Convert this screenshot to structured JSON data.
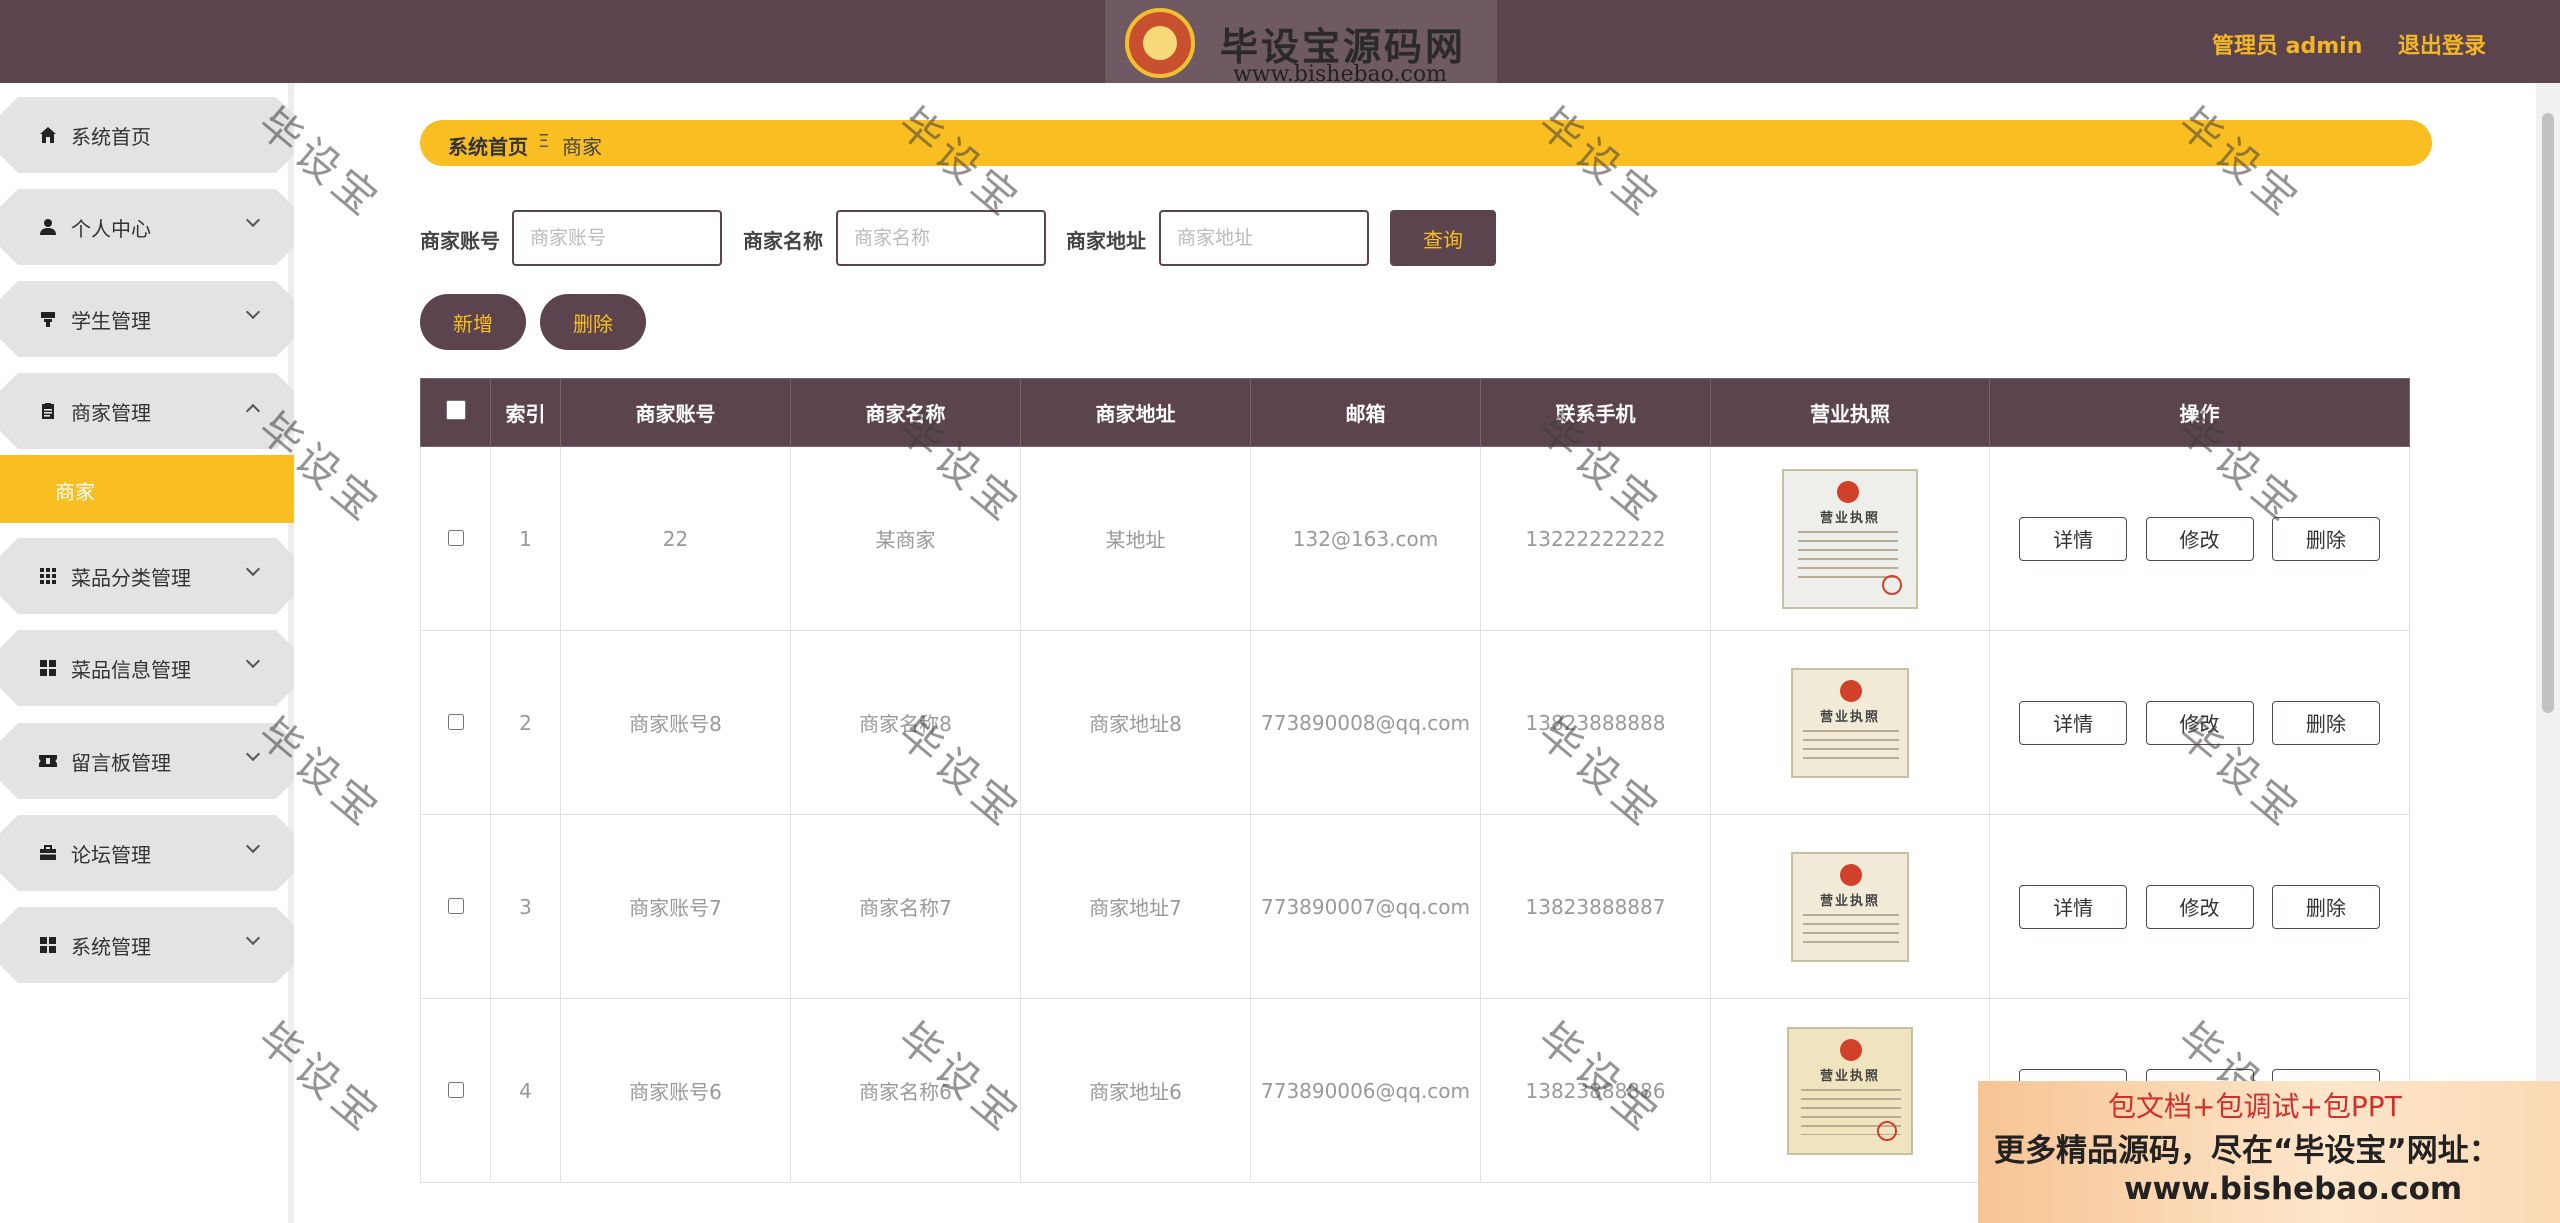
{
  "header": {
    "logo_title": "毕设宝源码网",
    "logo_url": "www.bishebao.com",
    "admin_label": "管理员 admin",
    "logout_label": "退出登录"
  },
  "sidebar": {
    "items": [
      {
        "label": "系统首页",
        "icon": "home-icon"
      },
      {
        "label": "个人中心",
        "icon": "user-icon"
      },
      {
        "label": "学生管理",
        "icon": "student-icon"
      },
      {
        "label": "商家管理",
        "icon": "clipboard-icon"
      },
      {
        "label": "菜品分类管理",
        "icon": "grid-icon"
      },
      {
        "label": "菜品信息管理",
        "icon": "apps-icon"
      },
      {
        "label": "留言板管理",
        "icon": "ticket-icon"
      },
      {
        "label": "论坛管理",
        "icon": "briefcase-icon"
      },
      {
        "label": "系统管理",
        "icon": "apps-icon"
      }
    ],
    "sub_item": "商家"
  },
  "breadcrumb": {
    "home": "系统首页",
    "separator": "Ξ",
    "current": "商家"
  },
  "search": {
    "account_label": "商家账号",
    "account_placeholder": "商家账号",
    "name_label": "商家名称",
    "name_placeholder": "商家名称",
    "address_label": "商家地址",
    "address_placeholder": "商家地址",
    "query_label": "查询"
  },
  "actions": {
    "add_label": "新增",
    "delete_label": "删除"
  },
  "table": {
    "headers": [
      "索引",
      "商家账号",
      "商家名称",
      "商家地址",
      "邮箱",
      "联系手机",
      "营业执照",
      "操作"
    ],
    "license_text": "营业执照",
    "rows": [
      {
        "index": "1",
        "account": "22",
        "name": "某商家",
        "address": "某地址",
        "email": "132@163.com",
        "phone": "13222222222"
      },
      {
        "index": "2",
        "account": "商家账号8",
        "name": "商家名称8",
        "address": "商家地址8",
        "email": "773890008@qq.com",
        "phone": "13823888888"
      },
      {
        "index": "3",
        "account": "商家账号7",
        "name": "商家名称7",
        "address": "商家地址7",
        "email": "773890007@qq.com",
        "phone": "13823888887"
      },
      {
        "index": "4",
        "account": "商家账号6",
        "name": "商家名称6",
        "address": "商家地址6",
        "email": "773890006@qq.com",
        "phone": "13823888886"
      }
    ],
    "op_detail": "详情",
    "op_edit": "修改",
    "op_delete": "删除"
  },
  "watermark_text": "毕设宝",
  "promo": {
    "line1": "包文档+包调试+包PPT",
    "line2": "更多精品源码，尽在“毕设宝”网址：",
    "line3": "www.bishebao.com"
  },
  "colors": {
    "primary": "#5c444e",
    "accent": "#f8be22",
    "header_text": "#f3b624"
  }
}
